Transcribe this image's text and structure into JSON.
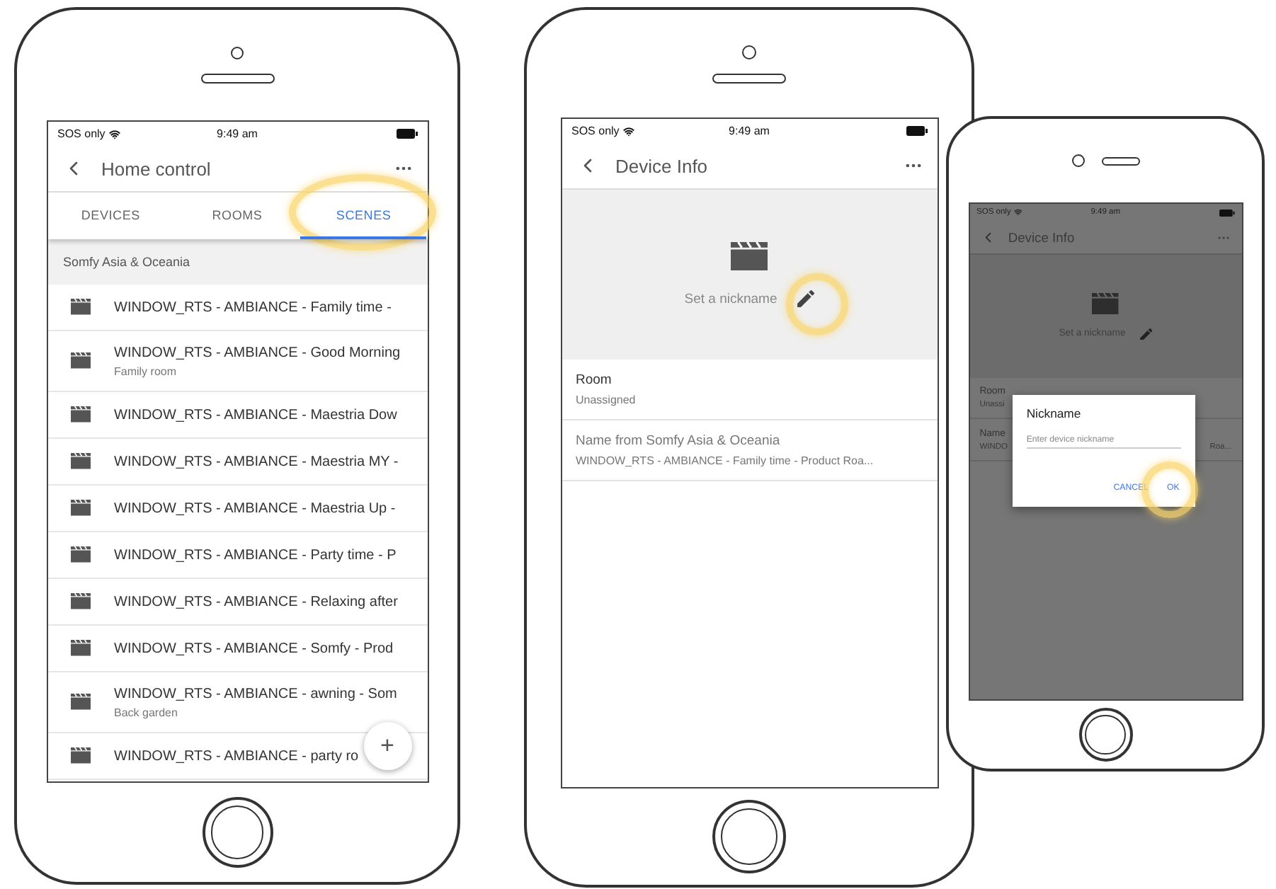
{
  "phones": [
    {
      "kind": "scene_list",
      "status": {
        "carrier": "SOS only",
        "time": "9:49 am"
      },
      "title": "Home control",
      "tabs": [
        {
          "label": "DEVICES",
          "selected": false
        },
        {
          "label": "ROOMS",
          "selected": false
        },
        {
          "label": "SCENES",
          "selected": true
        }
      ],
      "section": "Somfy Asia & Oceania",
      "rows": [
        {
          "title": "WINDOW_RTS - AMBIANCE - Family time -"
        },
        {
          "title": "WINDOW_RTS - AMBIANCE - Good Morning",
          "subtitle": "Family room"
        },
        {
          "title": "WINDOW_RTS - AMBIANCE - Maestria Dow"
        },
        {
          "title": "WINDOW_RTS - AMBIANCE - Maestria MY -"
        },
        {
          "title": "WINDOW_RTS - AMBIANCE - Maestria Up -"
        },
        {
          "title": "WINDOW_RTS - AMBIANCE - Party time - P"
        },
        {
          "title": "WINDOW_RTS - AMBIANCE - Relaxing after"
        },
        {
          "title": "WINDOW_RTS - AMBIANCE - Somfy - Prod"
        },
        {
          "title": "WINDOW_RTS - AMBIANCE - awning - Som",
          "subtitle": "Back garden"
        },
        {
          "title": "WINDOW_RTS - AMBIANCE - party ro"
        }
      ],
      "fab": "+"
    },
    {
      "kind": "device_info",
      "status": {
        "carrier": "SOS only",
        "time": "9:49 am"
      },
      "title": "Device Info",
      "nickname": "Set a nickname",
      "fields": [
        {
          "label": "Room",
          "value": "Unassigned"
        },
        {
          "label": "Name from Somfy Asia & Oceania",
          "value": "WINDOW_RTS - AMBIANCE - Family time - Product Roa..."
        }
      ]
    },
    {
      "kind": "device_info_dialog",
      "status": {
        "carrier": "SOS only",
        "time": "9:49 am"
      },
      "title": "Device Info",
      "nickname": "Set a nickname",
      "fields": [
        {
          "label": "Room",
          "value": "Unassi"
        },
        {
          "label": "Name",
          "value": "WINDO",
          "value_end": "Roa..."
        }
      ],
      "dialog": {
        "title": "Nickname",
        "placeholder": "Enter device nickname",
        "buttons": [
          "CANCEL",
          "OK"
        ]
      }
    }
  ]
}
